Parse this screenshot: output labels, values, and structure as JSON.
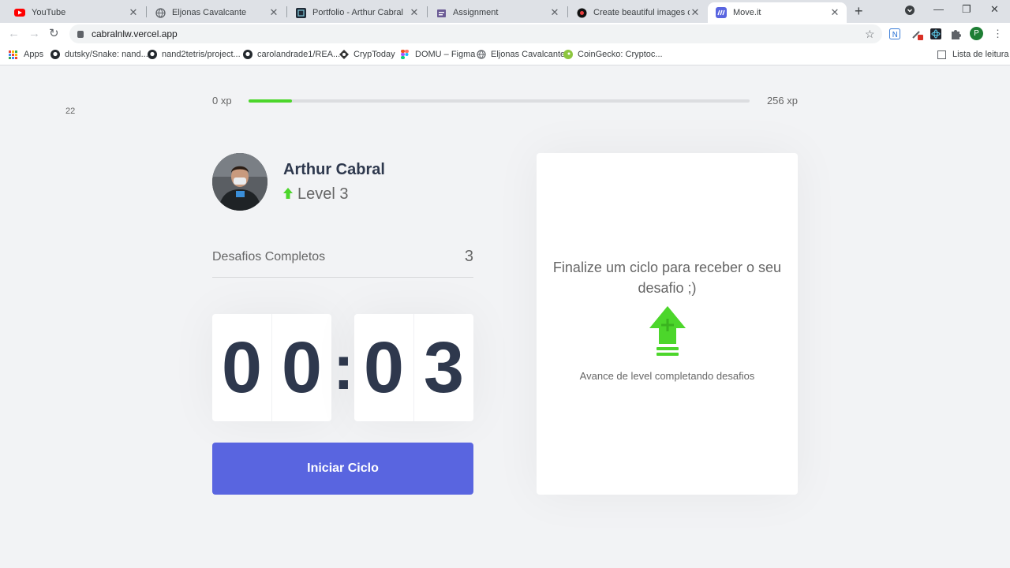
{
  "browser": {
    "tabs": [
      {
        "title": "YouTube",
        "icon": "youtube-icon",
        "active": false
      },
      {
        "title": "Eljonas Cavalcante",
        "icon": "globe-icon",
        "active": false
      },
      {
        "title": "Portfolio - Arthur Cabral",
        "icon": "portfolio-icon",
        "active": false
      },
      {
        "title": "Assignment",
        "icon": "assignment-icon",
        "active": false
      },
      {
        "title": "Create beautiful images of yo",
        "icon": "carbon-icon",
        "active": false
      },
      {
        "title": "Move.it",
        "icon": "moveit-icon",
        "active": true
      }
    ],
    "url": "cabralnlw.vercel.app",
    "profile_initial": "P",
    "bookmarks": [
      {
        "label": "Apps",
        "icon": "apps-grid-icon"
      },
      {
        "label": "dutsky/Snake: nand...",
        "icon": "github-icon"
      },
      {
        "label": "nand2tetris/project...",
        "icon": "github-icon"
      },
      {
        "label": "carolandrade1/REA...",
        "icon": "github-icon"
      },
      {
        "label": "CrypToday",
        "icon": "cryptoday-icon"
      },
      {
        "label": "DOMU – Figma",
        "icon": "figma-icon"
      },
      {
        "label": "Eljonas Cavalcante",
        "icon": "globe-icon"
      },
      {
        "label": "CoinGecko: Cryptoc...",
        "icon": "coingecko-icon"
      }
    ],
    "reading_list": "Lista de leitura"
  },
  "xp": {
    "min_label": "0 xp",
    "max_label": "256 xp",
    "current_label": "22",
    "current": 22,
    "max": 256
  },
  "profile": {
    "name": "Arthur Cabral",
    "level": "Level 3"
  },
  "challenges": {
    "label": "Desafios Completos",
    "count": "3"
  },
  "countdown": {
    "min_left": "0",
    "min_right": "0",
    "colon": ":",
    "sec_left": "0",
    "sec_right": "3"
  },
  "start_button": "Iniciar Ciclo",
  "challenge_box": {
    "message": "Finalize um ciclo para receber o seu desafio ;)",
    "hint": "Avance de level completando desafios"
  },
  "colors": {
    "primary": "#5965e0",
    "green": "#4cd62b",
    "title": "#2e384d",
    "text": "#666666",
    "background": "#f2f3f5"
  }
}
